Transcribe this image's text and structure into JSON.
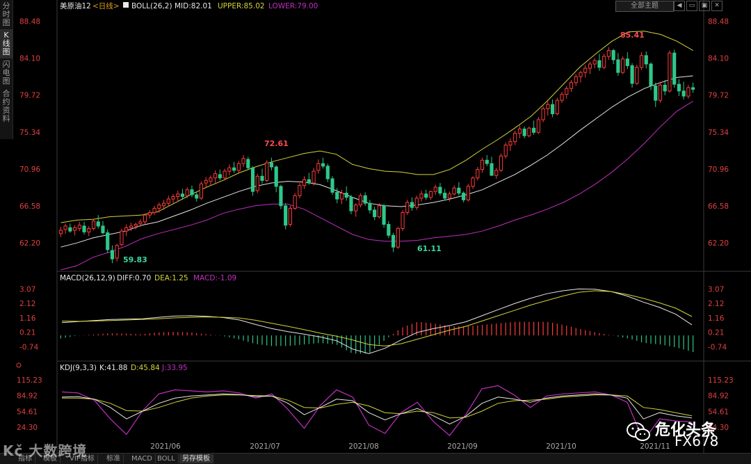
{
  "side_tabs": [
    "分时图",
    "K线图",
    "闪电图",
    "合约资料"
  ],
  "active_side_tab": 1,
  "main": {
    "symbol": "美原油12",
    "period": "<日线>",
    "boll_label": "BOLL(26,2)",
    "mid": "MID:82.01",
    "upper": "UPPER:85.02",
    "lower": "LOWER:79.00",
    "y_ticks": [
      "88.48",
      "84.10",
      "79.72",
      "75.34",
      "70.96",
      "66.58",
      "62.20"
    ],
    "annotations": {
      "high1": "72.61",
      "high2": "85.41",
      "low1": "59.83",
      "low2": "61.11"
    }
  },
  "macd": {
    "label": "MACD(26,12,9)",
    "diff": "DIFF:0.70",
    "dea": "DEA:1.25",
    "macd": "MACD:-1.09",
    "y_ticks": [
      "3.07",
      "2.12",
      "1.16",
      "0.21",
      "-0.74"
    ]
  },
  "kdj": {
    "label": "KDJ(9,3,3)",
    "k": "K:41.88",
    "d": "D:45.84",
    "j": "J:33.95",
    "y_ticks": [
      "115.23",
      "84.92",
      "54.61",
      "24.30"
    ]
  },
  "x_ticks": [
    "2021/06",
    "2021/07",
    "2021/08",
    "2021/09",
    "2021/10",
    "2021/11"
  ],
  "template_button": "全部主题",
  "window_controls": [
    "◀",
    "▭",
    "▣",
    "✕"
  ],
  "bottom_tabs": [
    "指标",
    "模板",
    "VIP指标",
    "标准",
    "MACD",
    "BOLL",
    "另存模板"
  ],
  "active_bottom_tab": 6,
  "watermark": {
    "left": "Kč 大数跨境",
    "right_title": "危化头条",
    "right_sub": "FX678"
  },
  "colors": {
    "up": "#ff3b3b",
    "down": "#2ec78a",
    "upper_band": "#d4d43a",
    "mid_band": "#e6e6e6",
    "lower_band": "#c030c0",
    "axis_text": "#e04040",
    "annotation_up": "#ff4b4b",
    "annotation_down": "#3ed6a0"
  },
  "chart_data": {
    "type": "candlestick",
    "x_start": "2021-05-21",
    "price": {
      "ylim": [
        59.0,
        89.5
      ],
      "ohlc": [
        [
          63.3,
          64.1,
          62.9,
          63.7
        ],
        [
          63.8,
          64.5,
          63.3,
          64.2
        ],
        [
          64.0,
          64.5,
          63.4,
          63.6
        ],
        [
          63.7,
          64.3,
          63.1,
          64.0
        ],
        [
          63.9,
          64.7,
          63.6,
          64.3
        ],
        [
          64.2,
          64.7,
          63.2,
          63.5
        ],
        [
          63.5,
          64.2,
          63.0,
          63.9
        ],
        [
          63.9,
          65.0,
          63.7,
          64.8
        ],
        [
          64.7,
          65.5,
          63.9,
          64.2
        ],
        [
          64.2,
          64.8,
          63.2,
          63.4
        ],
        [
          63.4,
          63.8,
          61.0,
          61.4
        ],
        [
          61.3,
          61.9,
          59.8,
          60.3
        ],
        [
          60.4,
          62.1,
          60.0,
          61.9
        ],
        [
          62.0,
          63.9,
          61.8,
          63.6
        ],
        [
          63.6,
          64.4,
          63.0,
          64.0
        ],
        [
          64.0,
          64.6,
          63.6,
          64.2
        ],
        [
          64.2,
          64.6,
          63.8,
          64.4
        ],
        [
          64.5,
          65.0,
          64.1,
          64.7
        ],
        [
          64.7,
          65.7,
          64.4,
          65.5
        ],
        [
          65.5,
          66.1,
          65.1,
          65.8
        ],
        [
          65.8,
          66.6,
          65.5,
          66.3
        ],
        [
          66.3,
          67.0,
          65.8,
          66.7
        ],
        [
          66.6,
          67.3,
          66.1,
          66.9
        ],
        [
          66.9,
          67.8,
          66.5,
          67.4
        ],
        [
          67.4,
          68.0,
          66.9,
          67.7
        ],
        [
          67.7,
          68.4,
          67.1,
          68.0
        ],
        [
          68.0,
          68.6,
          67.3,
          67.7
        ],
        [
          67.8,
          68.8,
          67.5,
          68.5
        ],
        [
          68.5,
          69.0,
          67.6,
          67.9
        ],
        [
          67.9,
          68.2,
          67.1,
          67.5
        ],
        [
          67.5,
          69.5,
          67.3,
          69.2
        ],
        [
          69.3,
          70.0,
          68.8,
          69.6
        ],
        [
          69.5,
          70.2,
          69.0,
          69.9
        ],
        [
          69.9,
          70.8,
          69.3,
          70.4
        ],
        [
          70.3,
          70.9,
          69.6,
          69.9
        ],
        [
          69.9,
          71.0,
          69.6,
          70.7
        ],
        [
          70.7,
          71.5,
          70.2,
          71.1
        ],
        [
          71.1,
          71.8,
          70.5,
          70.8
        ],
        [
          70.8,
          71.9,
          70.5,
          71.6
        ],
        [
          71.6,
          72.61,
          71.2,
          72.2
        ],
        [
          72.1,
          72.4,
          70.9,
          71.1
        ],
        [
          71.1,
          71.3,
          67.8,
          68.3
        ],
        [
          68.4,
          70.4,
          68.1,
          70.1
        ],
        [
          70.1,
          71.0,
          69.2,
          69.6
        ],
        [
          69.6,
          72.0,
          69.4,
          71.7
        ],
        [
          71.7,
          72.3,
          70.8,
          71.2
        ],
        [
          71.2,
          71.4,
          68.2,
          68.9
        ],
        [
          68.9,
          69.1,
          66.2,
          66.6
        ],
        [
          66.6,
          66.9,
          63.8,
          64.3
        ],
        [
          64.4,
          66.6,
          64.1,
          66.3
        ],
        [
          66.3,
          68.1,
          66.1,
          67.8
        ],
        [
          67.8,
          69.3,
          67.5,
          69.0
        ],
        [
          69.0,
          70.1,
          68.6,
          69.7
        ],
        [
          69.7,
          70.5,
          69.1,
          69.3
        ],
        [
          69.3,
          71.1,
          69.0,
          70.7
        ],
        [
          70.8,
          72.1,
          70.4,
          71.6
        ],
        [
          71.6,
          72.3,
          71.0,
          71.3
        ],
        [
          71.3,
          71.6,
          69.4,
          69.8
        ],
        [
          69.8,
          70.1,
          67.9,
          68.2
        ],
        [
          68.2,
          68.7,
          66.9,
          67.4
        ],
        [
          67.4,
          68.5,
          66.8,
          68.1
        ],
        [
          68.1,
          68.9,
          67.2,
          67.6
        ],
        [
          67.6,
          67.9,
          65.6,
          66.0
        ],
        [
          66.0,
          66.9,
          65.3,
          66.7
        ],
        [
          66.7,
          68.1,
          66.4,
          67.8
        ],
        [
          67.8,
          68.2,
          66.6,
          66.9
        ],
        [
          66.9,
          67.3,
          65.7,
          66.1
        ],
        [
          66.1,
          66.5,
          64.9,
          65.3
        ],
        [
          65.3,
          66.9,
          65.1,
          66.6
        ],
        [
          66.6,
          66.8,
          64.0,
          64.4
        ],
        [
          64.4,
          64.8,
          62.8,
          63.1
        ],
        [
          63.1,
          63.4,
          61.11,
          61.7
        ],
        [
          61.7,
          64.1,
          61.5,
          63.9
        ],
        [
          63.9,
          66.1,
          63.6,
          65.8
        ],
        [
          65.8,
          67.3,
          65.5,
          67.0
        ],
        [
          67.0,
          67.6,
          66.0,
          66.4
        ],
        [
          66.4,
          67.8,
          66.1,
          67.5
        ],
        [
          67.5,
          68.4,
          67.1,
          68.0
        ],
        [
          68.0,
          68.5,
          67.3,
          67.6
        ],
        [
          67.6,
          68.4,
          67.3,
          68.3
        ],
        [
          68.3,
          69.1,
          67.9,
          68.8
        ],
        [
          68.8,
          69.3,
          67.8,
          68.1
        ],
        [
          68.1,
          68.6,
          67.2,
          67.5
        ],
        [
          67.5,
          68.3,
          67.1,
          68.0
        ],
        [
          68.0,
          69.0,
          67.8,
          68.7
        ],
        [
          68.7,
          69.4,
          67.8,
          68.1
        ],
        [
          68.1,
          68.3,
          67.0,
          67.3
        ],
        [
          67.3,
          69.2,
          67.1,
          68.9
        ],
        [
          68.9,
          70.1,
          68.6,
          69.9
        ],
        [
          69.9,
          71.2,
          69.6,
          70.9
        ],
        [
          70.9,
          72.3,
          70.5,
          72.0
        ],
        [
          72.0,
          72.6,
          71.3,
          71.6
        ],
        [
          71.6,
          72.4,
          70.8,
          70.2
        ],
        [
          70.2,
          71.1,
          69.8,
          70.8
        ],
        [
          70.8,
          72.8,
          70.6,
          72.5
        ],
        [
          72.5,
          74.1,
          72.2,
          73.8
        ],
        [
          73.8,
          74.6,
          73.1,
          74.2
        ],
        [
          74.2,
          75.5,
          73.8,
          75.2
        ],
        [
          75.2,
          76.1,
          74.6,
          75.7
        ],
        [
          75.7,
          76.0,
          74.6,
          74.9
        ],
        [
          74.9,
          76.0,
          74.7,
          75.8
        ],
        [
          75.8,
          76.7,
          75.0,
          75.3
        ],
        [
          75.3,
          77.1,
          75.1,
          76.8
        ],
        [
          76.8,
          78.4,
          76.5,
          78.1
        ],
        [
          78.1,
          79.0,
          77.3,
          78.6
        ],
        [
          78.6,
          79.2,
          77.1,
          77.5
        ],
        [
          77.5,
          79.4,
          77.3,
          79.1
        ],
        [
          79.1,
          80.1,
          78.8,
          79.8
        ],
        [
          79.8,
          80.8,
          79.3,
          80.5
        ],
        [
          80.5,
          81.5,
          80.1,
          81.2
        ],
        [
          81.2,
          82.2,
          80.8,
          81.9
        ],
        [
          81.9,
          82.6,
          81.2,
          82.4
        ],
        [
          82.4,
          83.3,
          81.8,
          82.9
        ],
        [
          82.9,
          83.7,
          82.2,
          83.4
        ],
        [
          83.4,
          84.1,
          82.9,
          83.8
        ],
        [
          83.8,
          84.6,
          82.6,
          83.0
        ],
        [
          83.0,
          84.6,
          82.8,
          84.3
        ],
        [
          84.3,
          85.41,
          83.9,
          85.0
        ],
        [
          85.0,
          85.2,
          83.4,
          83.9
        ],
        [
          83.9,
          84.7,
          82.0,
          82.4
        ],
        [
          82.4,
          84.3,
          82.2,
          84.0
        ],
        [
          84.0,
          84.8,
          82.8,
          83.2
        ],
        [
          83.2,
          83.5,
          80.6,
          81.1
        ],
        [
          81.1,
          83.3,
          80.9,
          83.0
        ],
        [
          83.0,
          84.8,
          82.7,
          84.4
        ],
        [
          84.4,
          84.9,
          82.9,
          83.4
        ],
        [
          83.4,
          83.6,
          80.3,
          80.8
        ],
        [
          80.8,
          81.2,
          78.3,
          79.1
        ],
        [
          79.1,
          81.3,
          78.8,
          80.9
        ],
        [
          80.9,
          81.5,
          79.7,
          80.2
        ],
        [
          80.2,
          85.0,
          80.0,
          84.7
        ],
        [
          84.7,
          85.1,
          80.6,
          81.0
        ],
        [
          81.0,
          81.6,
          79.6,
          80.2
        ],
        [
          80.2,
          81.3,
          79.2,
          79.6
        ],
        [
          79.6,
          80.9,
          79.3,
          80.6
        ],
        [
          80.6,
          81.2,
          80.0,
          80.4
        ]
      ],
      "boll_upper": [
        64.6,
        64.9,
        65.0,
        65.3,
        65.4,
        65.5,
        65.9,
        66.9,
        67.9,
        68.8,
        69.6,
        70.5,
        71.2,
        71.8,
        72.3,
        72.8,
        73.1,
        72.7,
        71.5,
        71.0,
        70.7,
        70.6,
        70.3,
        70.3,
        70.9,
        72.0,
        73.3,
        74.5,
        75.8,
        77.2,
        79.0,
        81.0,
        83.0,
        84.6,
        86.1,
        87.2,
        87.3,
        86.9,
        86.1,
        85.0
      ],
      "boll_mid": [
        61.7,
        62.2,
        62.8,
        63.2,
        63.6,
        64.3,
        64.7,
        65.4,
        66.1,
        66.9,
        67.6,
        68.3,
        68.9,
        69.3,
        69.5,
        69.4,
        69.1,
        68.4,
        67.6,
        66.9,
        66.6,
        66.5,
        66.7,
        67.0,
        67.4,
        67.9,
        68.5,
        69.4,
        70.3,
        71.4,
        72.6,
        74.0,
        75.5,
        76.9,
        78.3,
        79.5,
        80.5,
        81.2,
        81.8,
        82.0
      ],
      "boll_lower": [
        59.0,
        59.5,
        60.5,
        61.1,
        61.8,
        62.7,
        63.3,
        63.8,
        64.3,
        64.9,
        65.7,
        66.2,
        66.6,
        66.8,
        66.8,
        66.2,
        65.2,
        64.2,
        63.2,
        62.6,
        62.4,
        62.4,
        62.5,
        62.8,
        63.0,
        63.2,
        63.6,
        64.2,
        64.9,
        65.5,
        66.2,
        67.0,
        68.0,
        69.2,
        70.6,
        72.2,
        74.0,
        76.0,
        77.8,
        79.0
      ]
    },
    "macd": {
      "ylim": [
        -1.6,
        3.5
      ],
      "diff": [
        0.85,
        0.92,
        0.98,
        1.05,
        1.08,
        1.1,
        1.2,
        1.28,
        1.3,
        1.26,
        1.18,
        1.02,
        0.72,
        0.45,
        0.25,
        0.08,
        -0.1,
        -0.35,
        -0.9,
        -1.2,
        -0.85,
        -0.3,
        0.2,
        0.45,
        0.65,
        0.9,
        1.3,
        1.7,
        2.1,
        2.45,
        2.75,
        2.95,
        3.07,
        3.05,
        2.9,
        2.6,
        2.2,
        1.85,
        1.4,
        0.7
      ],
      "dea": [
        0.95,
        0.93,
        0.95,
        0.98,
        1.02,
        1.06,
        1.1,
        1.16,
        1.2,
        1.22,
        1.2,
        1.15,
        1.0,
        0.8,
        0.6,
        0.38,
        0.15,
        -0.05,
        -0.3,
        -0.6,
        -0.7,
        -0.55,
        -0.25,
        0.05,
        0.35,
        0.6,
        0.95,
        1.3,
        1.65,
        2.0,
        2.3,
        2.6,
        2.85,
        2.95,
        2.9,
        2.7,
        2.45,
        2.15,
        1.8,
        1.25
      ]
    },
    "kdj": {
      "ylim": [
        0,
        130
      ],
      "k": [
        82,
        83,
        78,
        62,
        40,
        55,
        70,
        80,
        84,
        86,
        88,
        87,
        83,
        84,
        70,
        48,
        62,
        78,
        75,
        52,
        38,
        50,
        60,
        46,
        30,
        45,
        70,
        82,
        78,
        72,
        80,
        84,
        86,
        88,
        86,
        80,
        40,
        52,
        46,
        41.88
      ],
      "d": [
        80,
        80,
        78,
        70,
        56,
        55,
        62,
        72,
        80,
        84,
        86,
        86,
        85,
        84,
        76,
        62,
        61,
        68,
        72,
        65,
        52,
        50,
        55,
        52,
        42,
        43,
        55,
        70,
        75,
        76,
        78,
        82,
        84,
        86,
        86,
        84,
        62,
        58,
        52,
        45.84
      ],
      "j": [
        92,
        90,
        76,
        40,
        10,
        56,
        88,
        96,
        94,
        92,
        94,
        90,
        80,
        88,
        58,
        22,
        66,
        96,
        82,
        28,
        12,
        52,
        72,
        35,
        8,
        48,
        98,
        104,
        86,
        62,
        84,
        88,
        90,
        92,
        86,
        72,
        -2,
        40,
        36,
        33.95
      ]
    }
  }
}
